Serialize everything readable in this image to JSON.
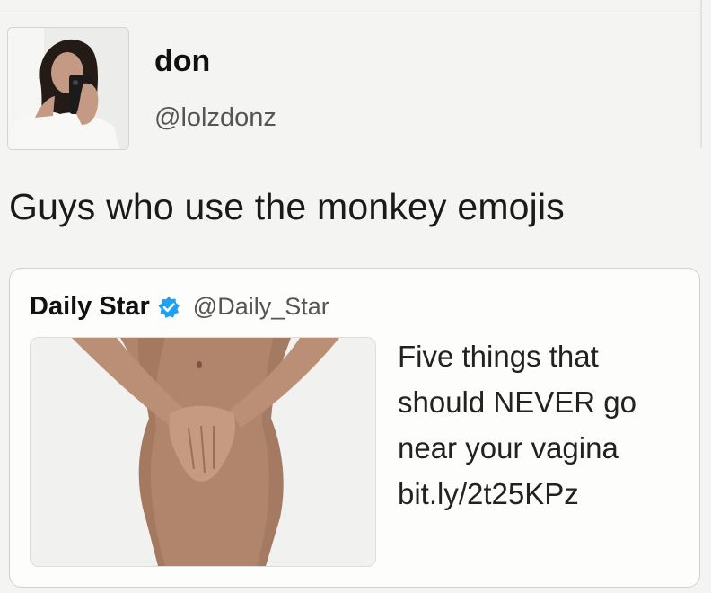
{
  "tweet": {
    "display_name": "don",
    "handle": "@lolzdonz",
    "text": "Guys who use the monkey emojis"
  },
  "quoted_tweet": {
    "display_name": "Daily Star",
    "verified_icon": "verified-badge-icon",
    "handle": "@Daily_Star",
    "text_lines": [
      "Five things that",
      "should NEVER go",
      "near your vagina",
      "bit.ly/2t25KPz"
    ]
  },
  "colors": {
    "verified": "#1da1f2",
    "background": "#f4f4f2",
    "border": "#d0d0d0"
  }
}
